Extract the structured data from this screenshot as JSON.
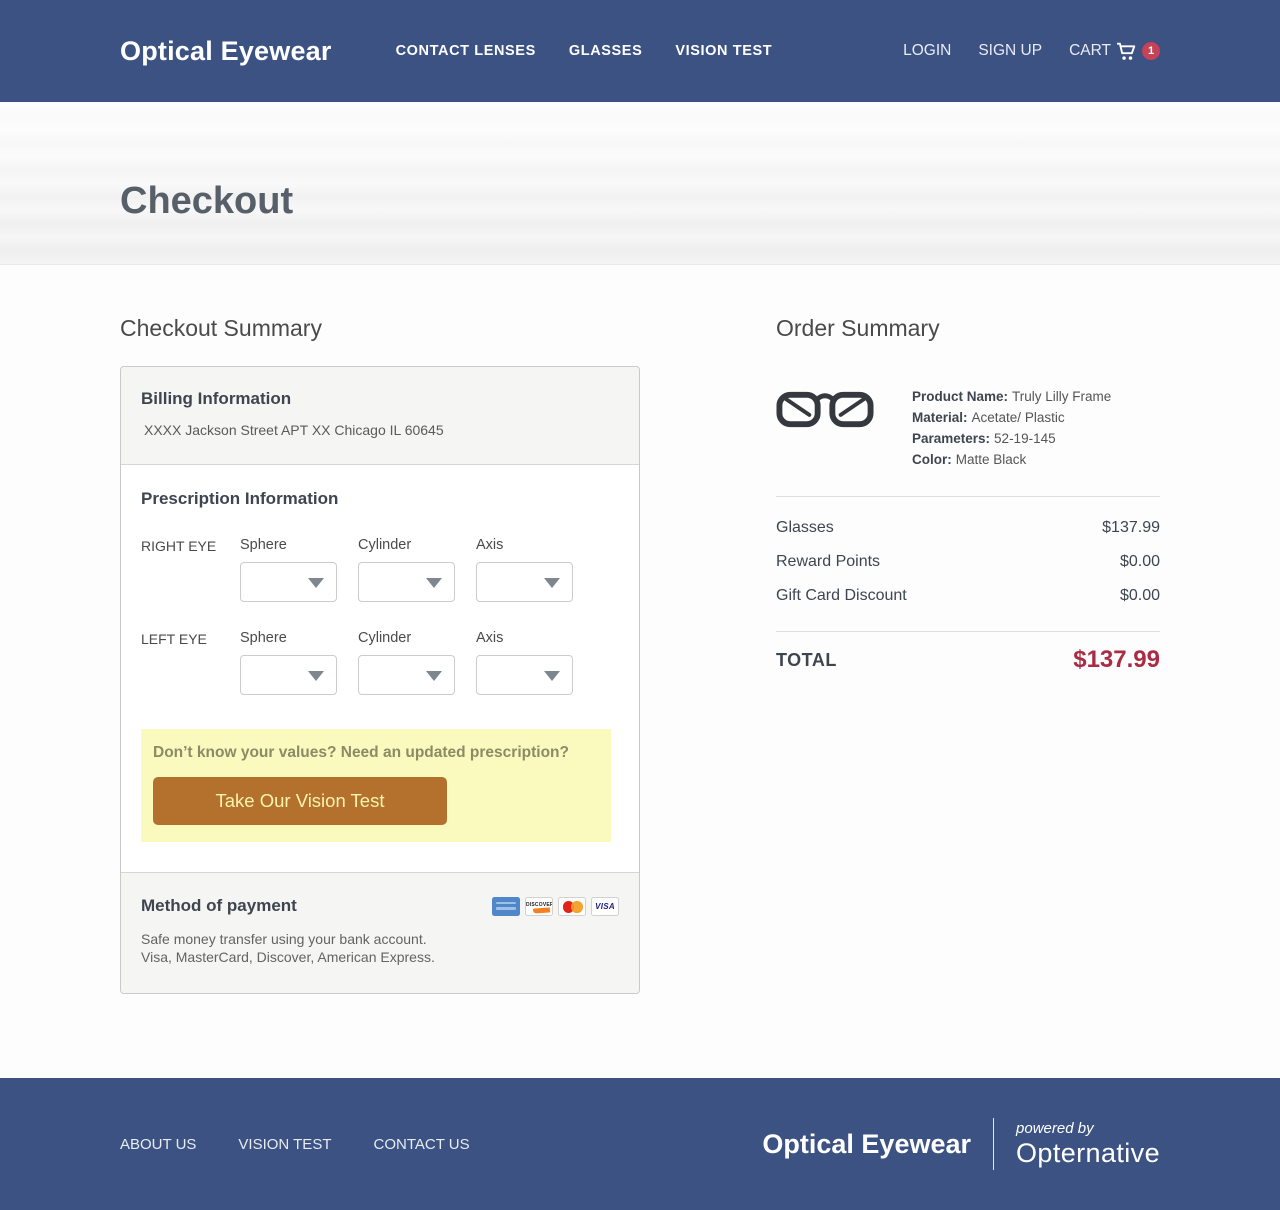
{
  "colors": {
    "navbar_bg": "#3B5283",
    "highlight_yellow": "#FAF9BE",
    "cta_orange": "#B4712E",
    "total_red": "#A92C45",
    "badge_red": "#C64256"
  },
  "nav": {
    "brand": "Optical Eyewear",
    "links": [
      {
        "label": "CONTACT LENSES"
      },
      {
        "label": "GLASSES"
      },
      {
        "label": "VISION TEST"
      }
    ],
    "account": [
      {
        "label": "LOGIN"
      },
      {
        "label": "SIGN UP"
      }
    ],
    "cart": {
      "label": "CART",
      "count": "1"
    }
  },
  "hero": {
    "title": "Checkout"
  },
  "checkout": {
    "heading": "Checkout Summary",
    "billing": {
      "heading": "Billing Information",
      "address": "XXXX Jackson Street APT XX Chicago IL 60645"
    },
    "prescription": {
      "heading": "Prescription Information",
      "rows": [
        {
          "eye": "RIGHT EYE",
          "fields": [
            {
              "label": "Sphere",
              "value": ""
            },
            {
              "label": "Cylinder",
              "value": ""
            },
            {
              "label": "Axis",
              "value": ""
            }
          ]
        },
        {
          "eye": "LEFT EYE",
          "fields": [
            {
              "label": "Sphere",
              "value": ""
            },
            {
              "label": "Cylinder",
              "value": ""
            },
            {
              "label": "Axis",
              "value": ""
            }
          ]
        }
      ]
    },
    "vision_cta": {
      "question": "Don’t know your values? Need an updated prescription?",
      "button": "Take Our Vision Test"
    },
    "payment": {
      "heading": "Method of payment",
      "line1": "Safe money transfer using your bank account.",
      "line2": "Visa, MasterCard, Discover, American Express.",
      "cards": [
        {
          "name": "american-express"
        },
        {
          "name": "discover",
          "short": "DISCOVER"
        },
        {
          "name": "mastercard"
        },
        {
          "name": "visa",
          "short": "VISA"
        }
      ]
    }
  },
  "order": {
    "heading": "Order Summary",
    "product": {
      "details": [
        {
          "label": "Product Name:",
          "value": "Truly Lilly Frame"
        },
        {
          "label": "Material:",
          "value": "Acetate/ Plastic"
        },
        {
          "label": "Parameters:",
          "value": "52-19-145"
        },
        {
          "label": "Color:",
          "value": "Matte Black"
        }
      ]
    },
    "lines": [
      {
        "label": "Glasses",
        "value": "$137.99"
      },
      {
        "label": "Reward Points",
        "value": "$0.00"
      },
      {
        "label": "Gift Card Discount",
        "value": "$0.00"
      }
    ],
    "total": {
      "label": "TOTAL",
      "value": "$137.99"
    }
  },
  "footer": {
    "links": [
      {
        "label": "ABOUT US"
      },
      {
        "label": "VISION TEST"
      },
      {
        "label": "CONTACT US"
      }
    ],
    "brand": "Optical Eyewear",
    "powered_by": "powered by",
    "powered_name": "Opternative"
  }
}
